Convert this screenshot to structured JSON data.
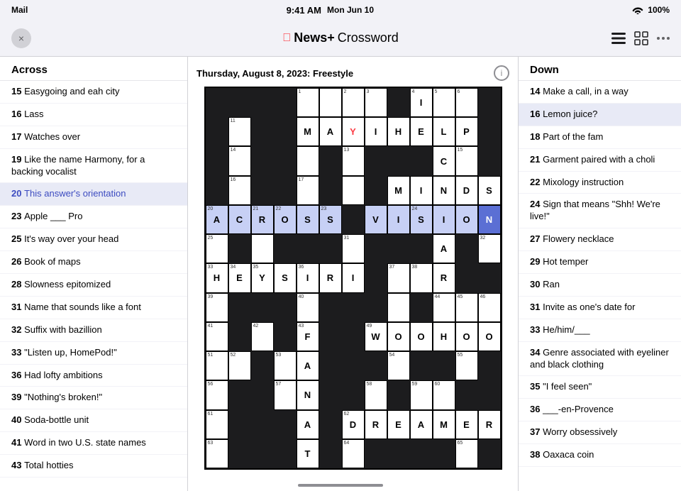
{
  "statusBar": {
    "carrier": "Mail",
    "time": "9:41 AM",
    "date": "Mon Jun 10",
    "wifi": "WiFi",
    "battery": "100%"
  },
  "titleBar": {
    "appName": "News+",
    "sectionName": "Crossword",
    "appleSymbol": ""
  },
  "puzzle": {
    "dateLabel": "Thursday, August 8, 2023: Freestyle"
  },
  "acrossClues": {
    "header": "Across",
    "items": [
      {
        "number": "15",
        "clue": "Easygoing and eah city"
      },
      {
        "number": "16",
        "clue": "Lass"
      },
      {
        "number": "17",
        "clue": "Watches over"
      },
      {
        "number": "19",
        "clue": "Like the name Harmony, for a backing vocalist"
      },
      {
        "number": "20",
        "clue": "This answer's orientation",
        "active": true
      },
      {
        "number": "23",
        "clue": "Apple ___ Pro"
      },
      {
        "number": "25",
        "clue": "It's way over your head"
      },
      {
        "number": "26",
        "clue": "Book of maps"
      },
      {
        "number": "28",
        "clue": "Slowness epitomized"
      },
      {
        "number": "31",
        "clue": "Name that sounds like a font"
      },
      {
        "number": "32",
        "clue": "Suffix with bazillion"
      },
      {
        "number": "33",
        "clue": "\"Listen up, HomePod!\""
      },
      {
        "number": "36",
        "clue": "Had lofty ambitions"
      },
      {
        "number": "39",
        "clue": "\"Nothing's broken!\""
      },
      {
        "number": "40",
        "clue": "Soda-bottle unit"
      },
      {
        "number": "41",
        "clue": "Word in two U.S. state names"
      },
      {
        "number": "43",
        "clue": "Total hotties"
      }
    ]
  },
  "downClues": {
    "header": "Down",
    "items": [
      {
        "number": "14",
        "clue": "Make a call, in a way"
      },
      {
        "number": "16",
        "clue": "Lemon juice?",
        "active": true
      },
      {
        "number": "18",
        "clue": "Part of the fam"
      },
      {
        "number": "21",
        "clue": "Garment paired with a choli"
      },
      {
        "number": "22",
        "clue": "Mixology instruction"
      },
      {
        "number": "24",
        "clue": "Sign that means \"Shh! We're live!\""
      },
      {
        "number": "27",
        "clue": "Flowery necklace"
      },
      {
        "number": "29",
        "clue": "Hot temper"
      },
      {
        "number": "30",
        "clue": "Ran"
      },
      {
        "number": "31",
        "clue": "Invite as one's date for"
      },
      {
        "number": "33",
        "clue": "He/him/___"
      },
      {
        "number": "34",
        "clue": "Genre associated with eyeliner and black clothing"
      },
      {
        "number": "35",
        "clue": "\"I feel seen\""
      },
      {
        "number": "36",
        "clue": "___-en-Provence"
      },
      {
        "number": "37",
        "clue": "Worry obsessively"
      },
      {
        "number": "38",
        "clue": "Oaxaca coin"
      }
    ]
  },
  "grid": {
    "cols": 13,
    "rows": 13
  },
  "icons": {
    "close": "×",
    "list": "≡",
    "grid": "⊞",
    "more": "•••",
    "info": "i"
  }
}
